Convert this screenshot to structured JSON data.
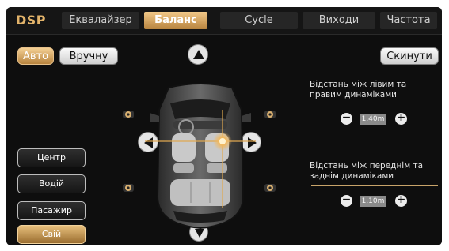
{
  "header": {
    "app_title": "DSP",
    "tabs": [
      {
        "label": "Еквалайзер",
        "active": false
      },
      {
        "label": "Баланс",
        "active": true
      },
      {
        "label": "Cycle",
        "active": false
      },
      {
        "label": "Виходи",
        "active": false
      },
      {
        "label": "Частота",
        "active": false
      }
    ]
  },
  "mode": {
    "auto_label": "Авто",
    "manual_label": "Вручну",
    "selected": "Авто"
  },
  "reset_label": "Скинути",
  "presets": [
    {
      "label": "Центр",
      "active": false
    },
    {
      "label": "Водій",
      "active": false
    },
    {
      "label": "Пасажир",
      "active": false
    },
    {
      "label": "Свій",
      "active": true
    }
  ],
  "left_right_distance": {
    "label": "Відстань між лівим та правим динаміками",
    "value": "1.40m"
  },
  "front_rear_distance": {
    "label": "Відстань між переднім та заднім динаміками",
    "value": "1.10m"
  },
  "colors": {
    "accent": "#e2b36a",
    "active_gradient_top": "#f1c888",
    "active_gradient_bottom": "#b8843f"
  }
}
